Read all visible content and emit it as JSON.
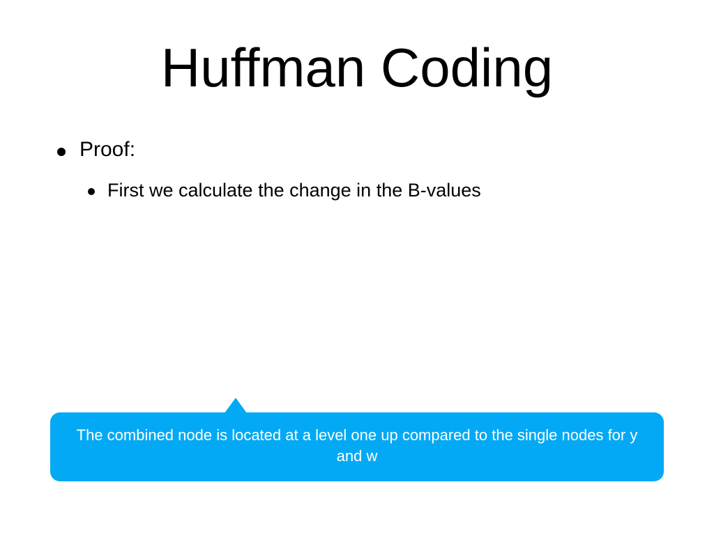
{
  "title": "Huffman Coding",
  "bullet1": "Proof:",
  "bullet2": "First we calculate the change in the B-values",
  "callout": "The combined node is located at a level one up compared to the single nodes for y and w"
}
